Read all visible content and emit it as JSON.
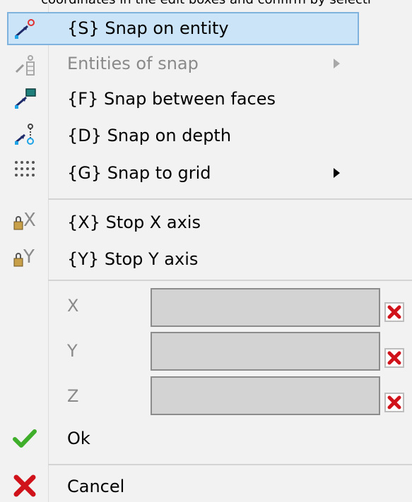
{
  "top_text": "coordinates in the edit boxes and confirm by selecti",
  "menu": {
    "snap_on_entity": "{S} Snap on entity",
    "entities_of_snap": "Entities of snap",
    "snap_between_faces": "{F} Snap between faces",
    "snap_on_depth": "{D} Snap on depth",
    "snap_to_grid": "{G} Snap to grid",
    "stop_x": "{X} Stop X axis",
    "stop_y": "{Y} Stop Y axis",
    "x_label": "X",
    "y_label": "Y",
    "z_label": "Z",
    "x_value": "",
    "y_value": "",
    "z_value": "",
    "ok": "Ok",
    "cancel": "Cancel"
  },
  "colors": {
    "highlight": "#cce4f7",
    "highlight_border": "#7fb2dd",
    "ok_check": "#3fae2a",
    "cancel_x": "#d0121b"
  }
}
